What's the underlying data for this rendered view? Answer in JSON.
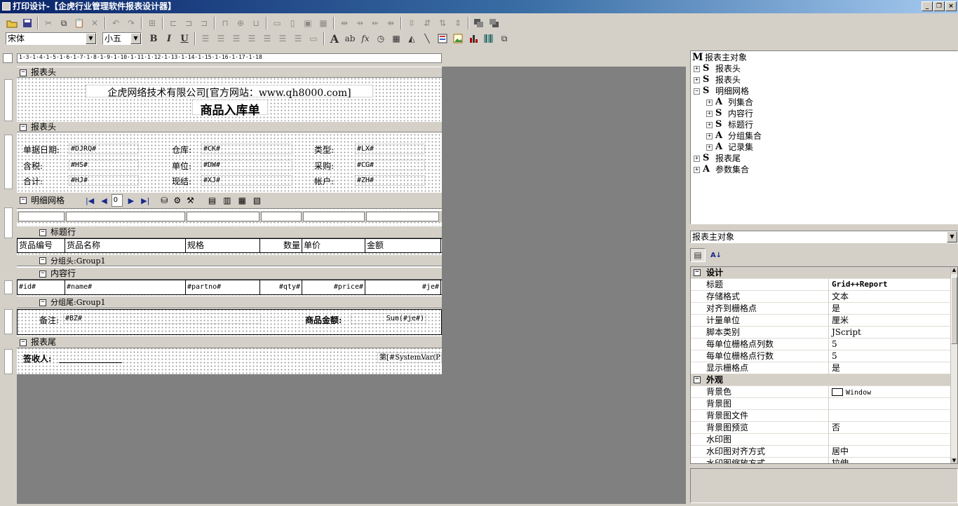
{
  "window": {
    "title": "打印设计-【企虎行业管理软件报表设计器】",
    "btn_min": "_",
    "btn_restore": "❐",
    "btn_close": "×"
  },
  "toolbar2": {
    "font_name": "宋体",
    "font_size": "小五",
    "bold": "B",
    "italic": "I",
    "underline": "U",
    "text_a": "A",
    "text_ab": "ab",
    "fx": "fx"
  },
  "top_ruler": "1·3·1·4·1·5·1·6·1·7·1·8·1·9·1·10·1·11·1·12·1·13·1·14·1·15·1·16·1·17·1·18",
  "bands": {
    "report_header1": "报表头",
    "report_header2": "报表头",
    "detail_grid": "明细网格",
    "title_row": "标题行",
    "group_header": "分组头:Group1",
    "content_row": "内容行",
    "group_footer": "分组尾:Group1",
    "report_footer": "报表尾"
  },
  "header1": {
    "company": "企虎网络技术有限公司[官方网站：www.qh8000.com]",
    "doc_title": "商品入库单"
  },
  "header2": {
    "rows": [
      [
        {
          "label": "单据日期:",
          "field": "#DJRQ#"
        },
        {
          "label": "仓库:",
          "field": "#CK#"
        },
        {
          "label": "类型:",
          "field": "#LX#"
        }
      ],
      [
        {
          "label": "含税:",
          "field": "#HS#"
        },
        {
          "label": "单位:",
          "field": "#DW#"
        },
        {
          "label": "采购:",
          "field": "#CG#"
        }
      ],
      [
        {
          "label": "合计:",
          "field": "#HJ#"
        },
        {
          "label": "现结:",
          "field": "#XJ#"
        },
        {
          "label": "帐户:",
          "field": "#ZH#"
        }
      ]
    ]
  },
  "nav": {
    "page_input": "0"
  },
  "grid": {
    "columns": [
      "货品编号",
      "货品名称",
      "规格",
      "数量",
      "单价",
      "金额"
    ],
    "content": [
      "#id#",
      "#name#",
      "#partno#",
      "#qty#",
      "#price#",
      "#je#"
    ]
  },
  "group_footer": {
    "remark_label": "备注:",
    "remark_field": "#BZ#",
    "total_label": "商品金额:",
    "total_field": "Sum(#je#)"
  },
  "footer": {
    "signer_label": "签收人:",
    "page_field": "第[#SystemVar(P"
  },
  "tree": {
    "root": "报表主对象",
    "nodes": [
      {
        "icon": "S",
        "label": "报表头",
        "toggle": "+",
        "level": 0
      },
      {
        "icon": "S",
        "label": "报表头",
        "toggle": "+",
        "level": 0
      },
      {
        "icon": "S",
        "label": "明细网格",
        "toggle": "−",
        "level": 0
      },
      {
        "icon": "A",
        "label": "列集合",
        "toggle": "+",
        "level": 1
      },
      {
        "icon": "S",
        "label": "内容行",
        "toggle": "+",
        "level": 1
      },
      {
        "icon": "S",
        "label": "标题行",
        "toggle": "+",
        "level": 1
      },
      {
        "icon": "A",
        "label": "分组集合",
        "toggle": "+",
        "level": 1
      },
      {
        "icon": "A",
        "label": "记录集",
        "toggle": "+",
        "level": 1
      },
      {
        "icon": "S",
        "label": "报表尾",
        "toggle": "+",
        "level": 0
      },
      {
        "icon": "A",
        "label": "参数集合",
        "toggle": "+",
        "level": 0
      }
    ]
  },
  "object_select": {
    "value": "报表主对象"
  },
  "props": {
    "cat_design": "设计",
    "cat_appearance": "外观",
    "design": [
      {
        "name": "标题",
        "value": "Grid++Report"
      },
      {
        "name": "存储格式",
        "value": "文本"
      },
      {
        "name": "对齐到栅格点",
        "value": "是"
      },
      {
        "name": "计量单位",
        "value": "厘米"
      },
      {
        "name": "脚本类别",
        "value": "JScript"
      },
      {
        "name": "每单位栅格点列数",
        "value": "5"
      },
      {
        "name": "每单位栅格点行数",
        "value": "5"
      },
      {
        "name": "显示栅格点",
        "value": "是"
      }
    ],
    "appearance": [
      {
        "name": "背景色",
        "value": "Window"
      },
      {
        "name": "背景图",
        "value": ""
      },
      {
        "name": "背景图文件",
        "value": ""
      },
      {
        "name": "背景图预览",
        "value": "否"
      },
      {
        "name": "水印图",
        "value": ""
      },
      {
        "name": "水印图对齐方式",
        "value": "居中"
      },
      {
        "name": "水印图缩放方式",
        "value": "拉伸"
      }
    ]
  }
}
